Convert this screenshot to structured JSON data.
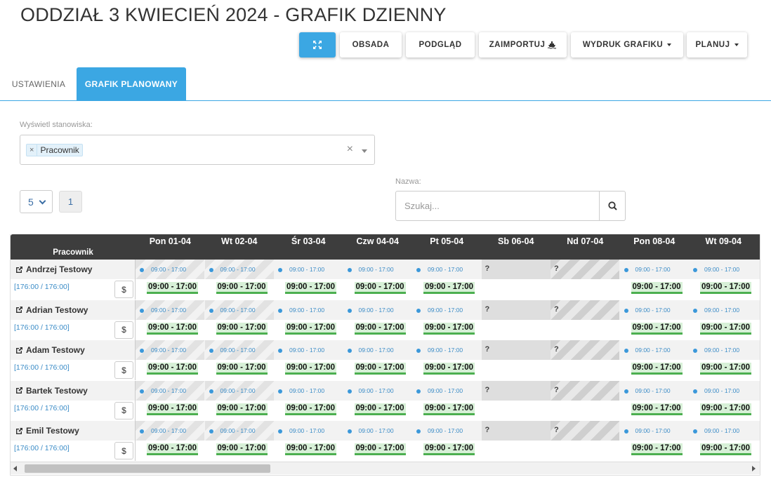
{
  "page_title": "ODDZIAŁ 3 KWIECIEŃ 2024 - GRAFIK DZIENNY",
  "toolbar": {
    "obsada": "OBSADA",
    "podglad": "PODGLĄD",
    "zaimportuj": "ZAIMPORTUJ",
    "wydruk": "WYDRUK GRAFIKU",
    "planuj": "PLANUJ"
  },
  "tabs": {
    "ustawienia": "USTAWIENIA",
    "grafik": "GRAFIK PLANOWANY"
  },
  "filter": {
    "label": "Wyświetl stanowiska:",
    "chip": "Pracownik",
    "clear": "×",
    "chip_remove": "×"
  },
  "pagination": {
    "per_page": "5",
    "page": "1"
  },
  "search": {
    "label": "Nazwa:",
    "placeholder": "Szukaj..."
  },
  "grid": {
    "employee_header": "Pracownik",
    "days": [
      "Pon 01-04",
      "Wt 02-04",
      "Śr 03-04",
      "Czw 04-04",
      "Pt 05-04",
      "Sb 06-04",
      "Nd 07-04",
      "Pon 08-04",
      "Wt 09-04"
    ],
    "day_types": [
      "work",
      "work",
      "work",
      "work",
      "work",
      "weekend",
      "weekend",
      "work",
      "work"
    ],
    "planned_text": "09:00 - 17:00",
    "shift_text": "09:00 - 17:00",
    "unknown_mark": "?",
    "dollar": "$",
    "employees": [
      {
        "name": "Andrzej Testowy",
        "hours": "[176:00 / 176:00]"
      },
      {
        "name": "Adrian Testowy",
        "hours": "[176:00 / 176:00]"
      },
      {
        "name": "Adam Testowy",
        "hours": "[176:00 / 176:00]"
      },
      {
        "name": "Bartek Testowy",
        "hours": "[176:00 / 176:00]"
      },
      {
        "name": "Emil Testowy",
        "hours": "[176:00 / 176:00]"
      }
    ]
  },
  "colors": {
    "accent": "#3ba7e3",
    "header_bg": "#3d3d3d",
    "shift_bg": "#d7f0d7",
    "shift_border": "#4caf50",
    "planned_text": "#3b8cc7"
  },
  "icons": {
    "expand": "expand-arrows-icon",
    "import": "ship-import-icon",
    "search": "search-icon",
    "external": "external-link-icon"
  }
}
